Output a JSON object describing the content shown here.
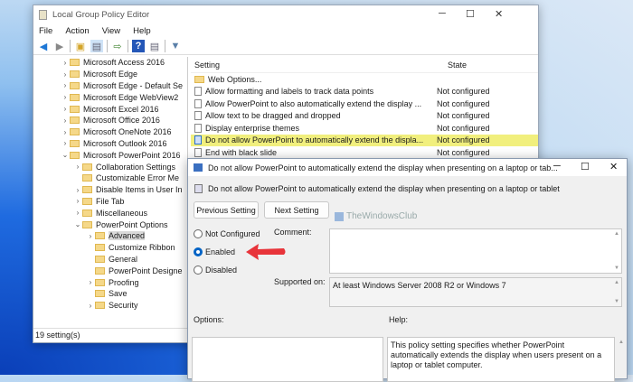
{
  "main_window": {
    "title": "Local Group Policy Editor",
    "menu": [
      "File",
      "Action",
      "View",
      "Help"
    ],
    "tree": [
      {
        "label": "Microsoft Access 2016",
        "depth": 0,
        "chevron": ">"
      },
      {
        "label": "Microsoft Edge",
        "depth": 0,
        "chevron": ">"
      },
      {
        "label": "Microsoft Edge - Default Se",
        "depth": 0,
        "chevron": ">"
      },
      {
        "label": "Microsoft Edge WebView2",
        "depth": 0,
        "chevron": ">"
      },
      {
        "label": "Microsoft Excel 2016",
        "depth": 0,
        "chevron": ">"
      },
      {
        "label": "Microsoft Office 2016",
        "depth": 0,
        "chevron": ">"
      },
      {
        "label": "Microsoft OneNote 2016",
        "depth": 0,
        "chevron": ">"
      },
      {
        "label": "Microsoft Outlook 2016",
        "depth": 0,
        "chevron": ">"
      },
      {
        "label": "Microsoft PowerPoint 2016",
        "depth": 0,
        "chevron": "v"
      },
      {
        "label": "Collaboration Settings",
        "depth": 1,
        "chevron": ">"
      },
      {
        "label": "Customizable Error Me",
        "depth": 1,
        "chevron": ""
      },
      {
        "label": "Disable Items in User In",
        "depth": 1,
        "chevron": ">"
      },
      {
        "label": "File Tab",
        "depth": 1,
        "chevron": ">"
      },
      {
        "label": "Miscellaneous",
        "depth": 1,
        "chevron": ">"
      },
      {
        "label": "PowerPoint Options",
        "depth": 1,
        "chevron": "v"
      },
      {
        "label": "Advanced",
        "depth": 2,
        "chevron": ">",
        "selected": true
      },
      {
        "label": "Customize Ribbon",
        "depth": 2,
        "chevron": ""
      },
      {
        "label": "General",
        "depth": 2,
        "chevron": ""
      },
      {
        "label": "PowerPoint Designe",
        "depth": 2,
        "chevron": ""
      },
      {
        "label": "Proofing",
        "depth": 2,
        "chevron": ">"
      },
      {
        "label": "Save",
        "depth": 2,
        "chevron": ""
      },
      {
        "label": "Security",
        "depth": 2,
        "chevron": ">"
      }
    ],
    "status": "19 setting(s)",
    "list": {
      "headers": {
        "setting": "Setting",
        "state": "State"
      },
      "rows": [
        {
          "name": "Web Options...",
          "state": "",
          "type": "folder"
        },
        {
          "name": "Allow formatting and labels to track data points",
          "state": "Not configured",
          "type": "doc"
        },
        {
          "name": "Allow PowerPoint to also automatically extend the display ...",
          "state": "Not configured",
          "type": "doc"
        },
        {
          "name": "Allow text to be dragged and dropped",
          "state": "Not configured",
          "type": "doc"
        },
        {
          "name": "Display enterprise themes",
          "state": "Not configured",
          "type": "doc"
        },
        {
          "name": "Do not allow PowerPoint to automatically extend the displa...",
          "state": "Not configured",
          "type": "doc",
          "highlighted": true
        },
        {
          "name": "End with black slide",
          "state": "Not configured",
          "type": "doc"
        }
      ]
    }
  },
  "dialog": {
    "title": "Do not allow PowerPoint to automatically extend the display when presenting on a laptop or tab...",
    "heading": "Do not allow PowerPoint to automatically extend the display when presenting on a laptop or tablet",
    "prev_button": "Previous Setting",
    "next_button": "Next Setting",
    "options": [
      "Not Configured",
      "Enabled",
      "Disabled"
    ],
    "selected": "Enabled",
    "comment_label": "Comment:",
    "supported_label": "Supported on:",
    "supported_value": "At least Windows Server 2008 R2 or Windows 7",
    "options_label": "Options:",
    "help_label": "Help:",
    "help_text": "This policy setting specifies whether PowerPoint automatically extends the display when users present on a laptop or tablet computer.",
    "watermark": "TheWindowsClub"
  },
  "colors": {
    "highlight": "#f1ef7d",
    "arrow": "#e8343a",
    "radio_on": "#0063c5"
  }
}
